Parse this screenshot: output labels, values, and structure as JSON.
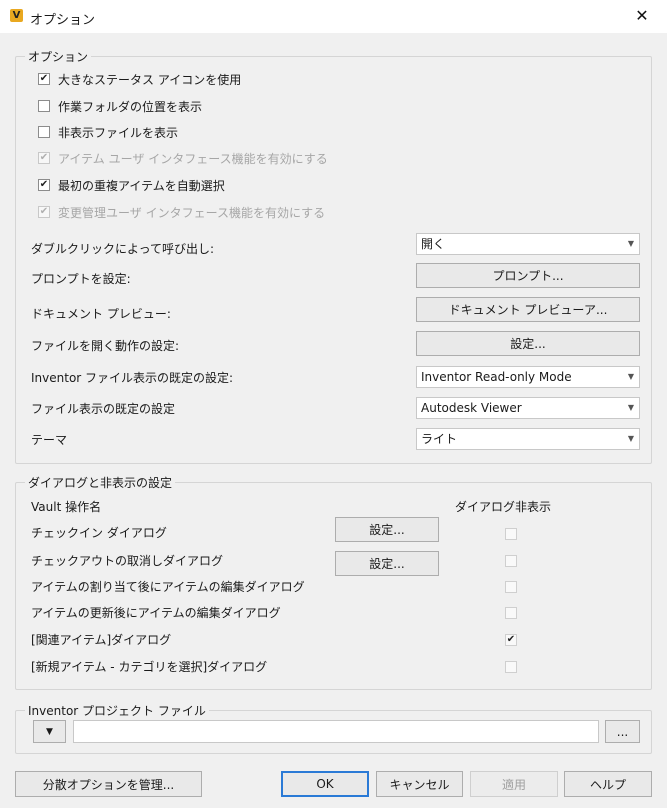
{
  "window": {
    "title": "オプション",
    "app_icon_letter": "V",
    "close_glyph": "✕"
  },
  "options": {
    "legend": "オプション",
    "checkboxes": [
      {
        "label": "大きなステータス アイコンを使用",
        "checked": true,
        "enabled": true
      },
      {
        "label": "作業フォルダの位置を表示",
        "checked": false,
        "enabled": true
      },
      {
        "label": "非表示ファイルを表示",
        "checked": false,
        "enabled": true
      },
      {
        "label": "アイテム ユーザ インタフェース機能を有効にする",
        "checked": true,
        "enabled": false
      },
      {
        "label": "最初の重複アイテムを自動選択",
        "checked": true,
        "enabled": true
      },
      {
        "label": "変更管理ユーザ インタフェース機能を有効にする",
        "checked": true,
        "enabled": false
      }
    ],
    "double_click": {
      "label": "ダブルクリックによって呼び出し:",
      "value": "開く"
    },
    "prompt": {
      "label": "プロンプトを設定:",
      "button": "プロンプト..."
    },
    "doc_preview": {
      "label": "ドキュメント プレビュー:",
      "button": "ドキュメント プレビューア..."
    },
    "file_open": {
      "label": "ファイルを開く動作の設定:",
      "button": "設定..."
    },
    "inventor_default": {
      "label": "Inventor ファイル表示の既定の設定:",
      "value": "Inventor Read-only Mode"
    },
    "file_view_default": {
      "label": "ファイル表示の既定の設定",
      "value": "Autodesk Viewer"
    },
    "theme": {
      "label": "テーマ",
      "value": "ライト"
    },
    "dropdown_glyph": "▼"
  },
  "dialogs": {
    "legend": "ダイアログと非表示の設定",
    "col_operation": "Vault 操作名",
    "col_hide": "ダイアログ非表示",
    "settings_label": "設定...",
    "rows": [
      {
        "label": "チェックイン ダイアログ",
        "has_settings": true,
        "hidden": false
      },
      {
        "label": "チェックアウトの取消しダイアログ",
        "has_settings": true,
        "hidden": false
      },
      {
        "label": "アイテムの割り当て後にアイテムの編集ダイアログ",
        "has_settings": false,
        "hidden": false
      },
      {
        "label": "アイテムの更新後にアイテムの編集ダイアログ",
        "has_settings": false,
        "hidden": false
      },
      {
        "label": "[関連アイテム]ダイアログ",
        "has_settings": false,
        "hidden": true
      },
      {
        "label": "[新規アイテム - カテゴリを選択]ダイアログ",
        "has_settings": false,
        "hidden": false
      }
    ]
  },
  "inventor_project": {
    "legend": "Inventor プロジェクト ファイル",
    "dropdown_glyph": "▼",
    "path_value": "",
    "browse_label": "..."
  },
  "footer": {
    "manage_label": "分散オプションを管理...",
    "ok_label": "OK",
    "cancel_label": "キャンセル",
    "apply_label": "適用",
    "help_label": "ヘルプ"
  },
  "check_glyph": "✔"
}
